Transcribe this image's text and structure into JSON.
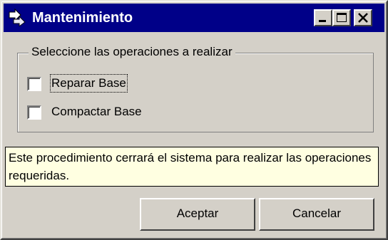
{
  "window": {
    "title": "Mantenimiento",
    "icon": "arrow-icon",
    "controls": [
      "minimize-icon",
      "maximize-icon",
      "close-icon"
    ]
  },
  "group": {
    "legend": "Seleccione las operaciones a realizar",
    "options": [
      {
        "label": "Reparar Base",
        "checked": false,
        "focused": true
      },
      {
        "label": "Compactar Base",
        "checked": false,
        "focused": false
      }
    ]
  },
  "info": {
    "text": "Este procedimiento cerrará el sistema para realizar las operaciones requeridas."
  },
  "buttons": {
    "accept": "Aceptar",
    "cancel": "Cancelar"
  },
  "colors": {
    "titlebar": "#000088",
    "face": "#d4d0c8",
    "info_bg": "#ffffe1"
  }
}
